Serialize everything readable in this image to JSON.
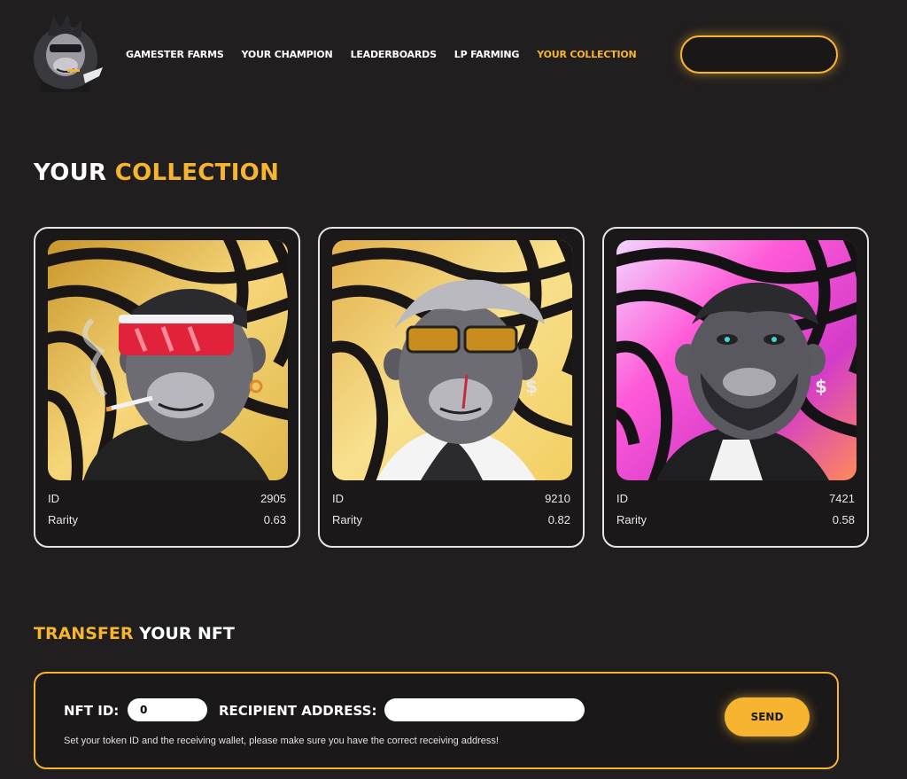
{
  "header": {
    "nav": [
      {
        "label": "GAMESTER FARMS"
      },
      {
        "label": "YOUR CHAMPION"
      },
      {
        "label": "LEADERBOARDS"
      },
      {
        "label": "LP FARMING"
      },
      {
        "label": "YOUR COLLECTION",
        "active": true
      }
    ],
    "wallet_button_label": ""
  },
  "collection": {
    "title_part1": "YOUR",
    "title_part2": "COLLECTION",
    "id_label": "ID",
    "rarity_label": "Rarity",
    "cards": [
      {
        "id": "2905",
        "rarity": "0.63",
        "art": "ape-red-visor-cigarette"
      },
      {
        "id": "9210",
        "rarity": "0.82",
        "art": "ape-gold-glasses-fur-coat"
      },
      {
        "id": "7421",
        "rarity": "0.58",
        "art": "ape-bearded-suit"
      }
    ]
  },
  "transfer": {
    "title_part1": "TRANSFER",
    "title_part2": "YOUR NFT",
    "nft_id_label": "NFT ID:",
    "nft_id_value": "0",
    "recipient_label": "RECIPIENT ADDRESS:",
    "recipient_value": "",
    "help_text": "Set your token ID and the receiving wallet, please make sure you have the correct receiving address!",
    "send_label": "SEND"
  },
  "colors": {
    "accent": "#f6b431",
    "background": "#211e1f",
    "card_border": "#e4e4e4"
  }
}
